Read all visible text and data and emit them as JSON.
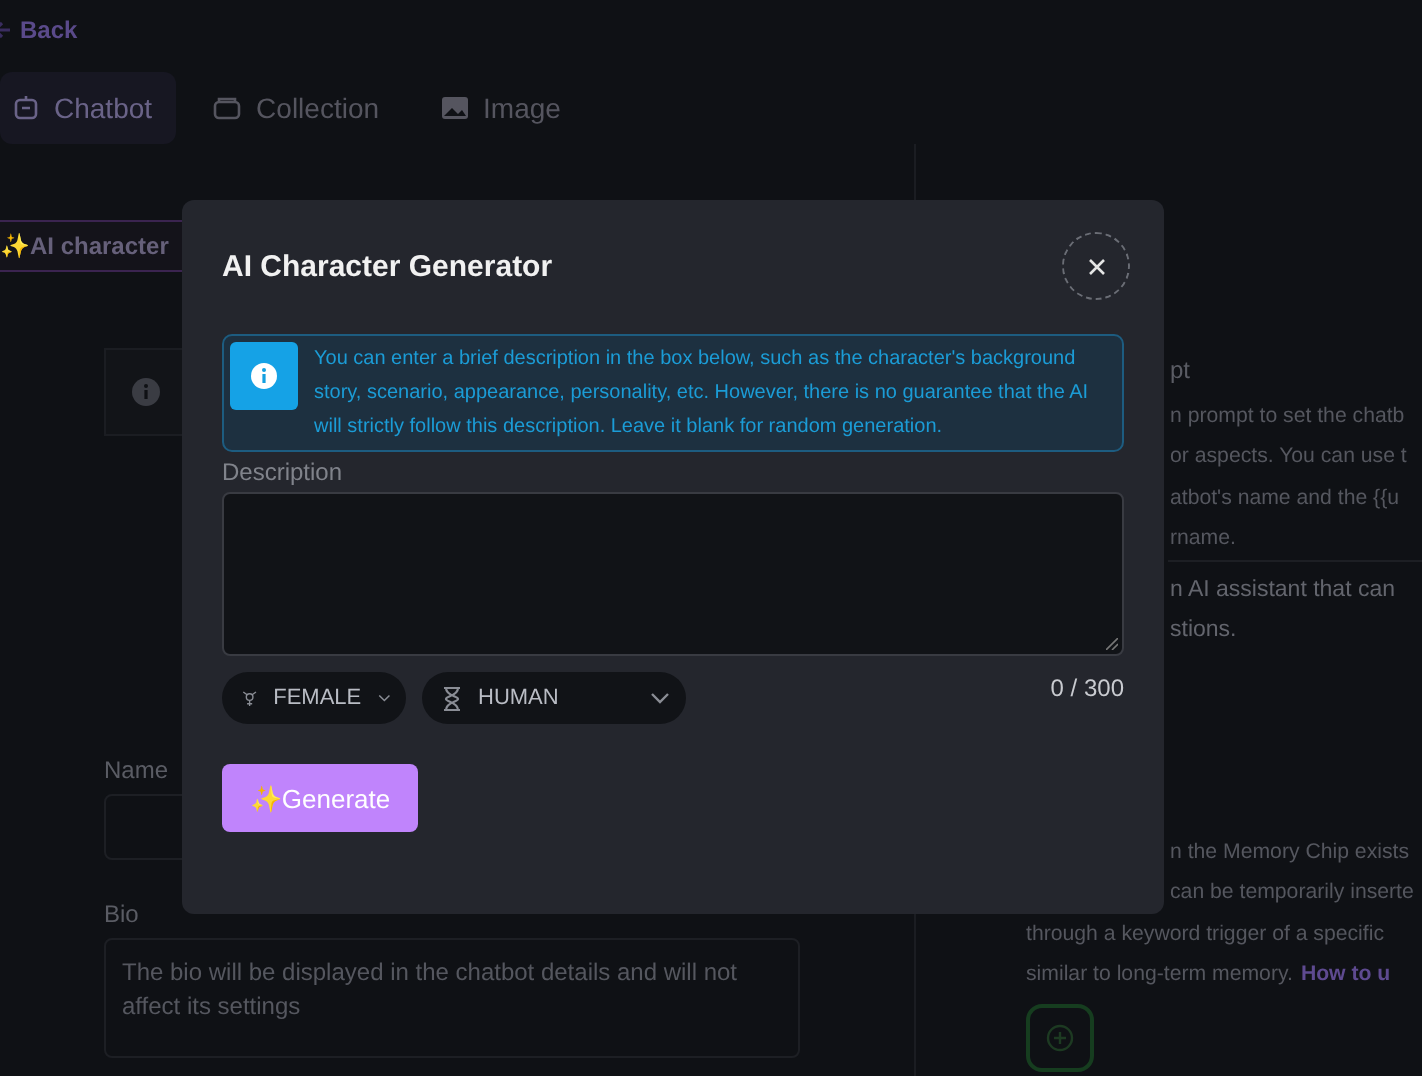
{
  "back": "Back",
  "tabs": [
    {
      "label": "Chatbot",
      "selected": true
    },
    {
      "label": "Collection",
      "selected": false
    },
    {
      "label": "Image",
      "selected": false
    }
  ],
  "ai_button": "✨AI character",
  "right_panel": {
    "heading": "pt",
    "prompt_lines": [
      {
        "text": "n prompt to set the chatb",
        "cut": true
      },
      {
        "text": "or aspects. You can use t",
        "cut": true
      },
      {
        "text": "atbot's name and the {{u",
        "cut": true
      },
      {
        "text": "rname.",
        "cut": true
      }
    ],
    "prompt_value_lines": [
      {
        "text": "n AI assistant that can",
        "cut": true
      },
      {
        "text": "stions.",
        "cut": true
      }
    ],
    "memory_lines": [
      {
        "text": "n the Memory Chip exists",
        "cut": true
      },
      {
        "text": "can be temporarily inserte",
        "cut": true
      },
      {
        "text": "through a keyword trigger of a specific",
        "cut": false
      }
    ],
    "memory_last": "similar to long-term memory.",
    "memory_link": "How to u"
  },
  "name_label": "Name",
  "bio_label": "Bio",
  "bio_placeholder": "The bio will be displayed in the chatbot details and will not affect its settings",
  "modal": {
    "title": "AI Character Generator",
    "info": "You can enter a brief description in the box below, such as the character's background story, scenario, appearance, personality, etc. However, there is no guarantee that the AI will strictly follow this description. Leave it blank for random generation.",
    "description_label": "Description",
    "selects": [
      {
        "value": "FEMALE"
      },
      {
        "value": "HUMAN"
      }
    ],
    "counter": "0 / 300",
    "generate": "✨Generate"
  }
}
